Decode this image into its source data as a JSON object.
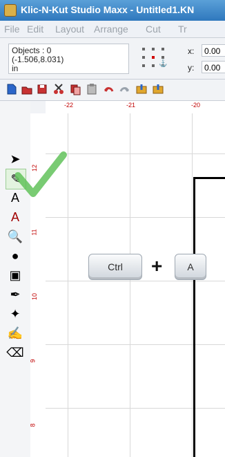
{
  "window": {
    "title": "Klic-N-Kut Studio Maxx - Untitled1.KN"
  },
  "menu": [
    "File",
    "Edit",
    "Layout",
    "Arrange",
    "Cut",
    "Tr"
  ],
  "properties": {
    "objects_line": "Objects : 0",
    "coords_line": "(-1.506,8.031)",
    "units_line": "in",
    "x_label": "x:",
    "y_label": "y:",
    "x_value": "0.00",
    "y_value": "0.00"
  },
  "ruler": {
    "horizontal": [
      "-22",
      "-21",
      "-20"
    ],
    "vertical": [
      "12",
      "11",
      "10",
      "9",
      "8"
    ]
  },
  "shortcut": {
    "key1": "Ctrl",
    "plus": "+",
    "key2": "A"
  },
  "colors": {
    "titlebar": "#2f78bd",
    "accent_red": "#c00000",
    "check_green": "#62c25a"
  },
  "left_tools": [
    "pointer-icon",
    "node-edit-icon",
    "text-icon",
    "text-effects-icon",
    "zoom-icon",
    "shape-icon",
    "image-icon",
    "pen-icon",
    "fill-icon",
    "freehand-icon",
    "eraser-icon"
  ],
  "top_tools": [
    "new-icon",
    "open-icon",
    "save-icon",
    "cut-icon",
    "copy-icon",
    "paste-icon",
    "undo-icon",
    "redo-icon",
    "import-icon",
    "export-icon"
  ]
}
